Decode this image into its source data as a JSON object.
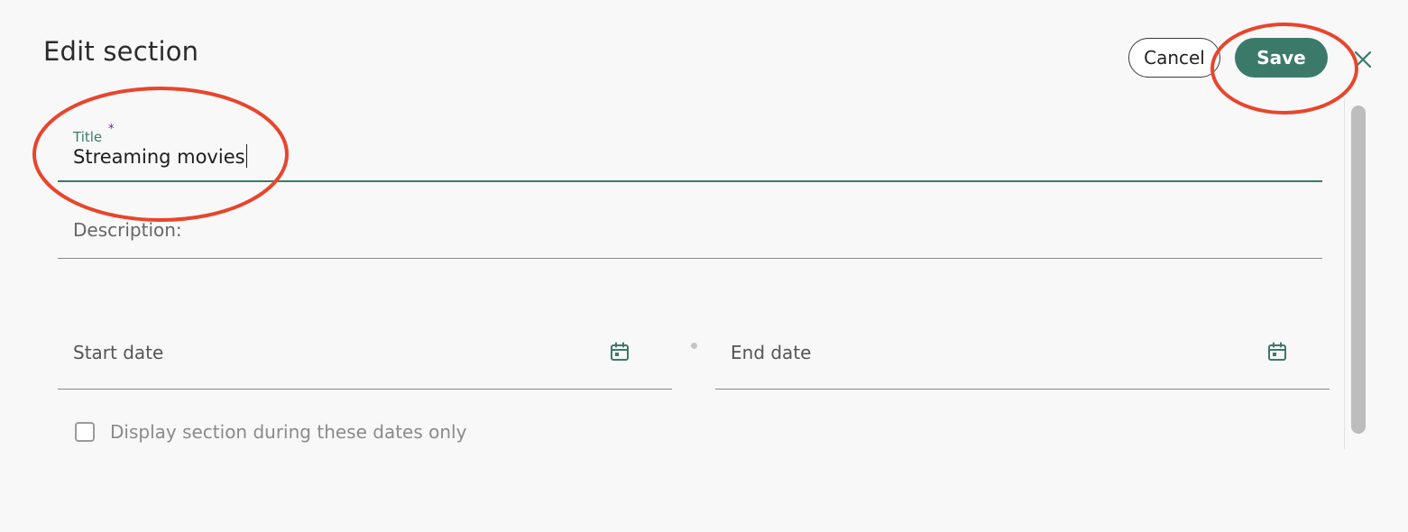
{
  "dialog": {
    "title": "Edit section",
    "cancel_label": "Cancel",
    "save_label": "Save",
    "close_icon": "close-icon"
  },
  "form": {
    "title_field": {
      "label": "Title",
      "required_mark": "*",
      "value": "Streaming movies"
    },
    "description_field": {
      "label": "Description:",
      "value": ""
    },
    "start_date": {
      "placeholder": "Start date",
      "icon": "calendar-icon"
    },
    "end_date": {
      "placeholder": "End date",
      "icon": "calendar-icon"
    },
    "display_only_checkbox": {
      "label": "Display section during these dates only",
      "checked": false
    }
  },
  "colors": {
    "accent": "#3b7a6b",
    "annotation": "#e8452c",
    "required": "#6a2a8a"
  }
}
